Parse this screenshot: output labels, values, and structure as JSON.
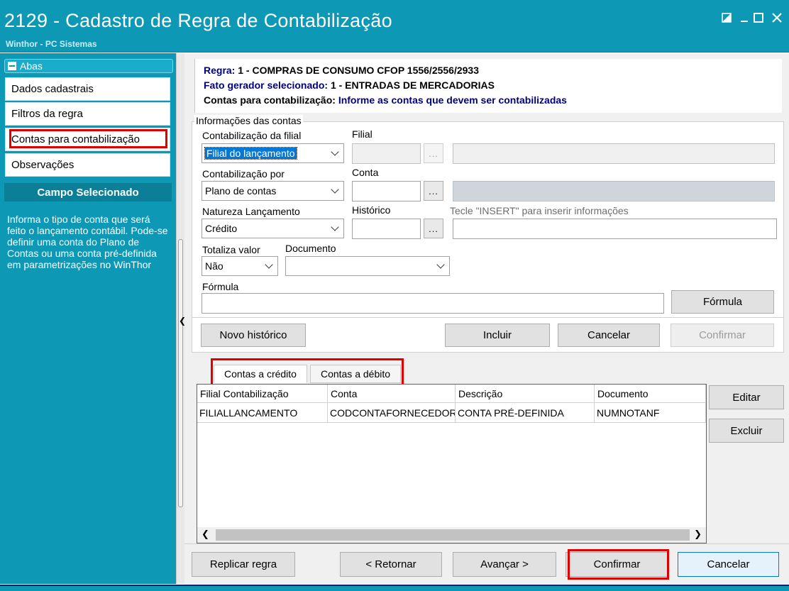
{
  "window": {
    "title": "2129 - Cadastro de Regra de Contabilização",
    "subtitle": "Winthor - PC Sistemas"
  },
  "sidebar": {
    "header": "Abas",
    "items": [
      {
        "label": "Dados cadastrais"
      },
      {
        "label": "Filtros da regra"
      },
      {
        "label": "Contas para contabilização"
      },
      {
        "label": "Observações"
      }
    ],
    "campo_title": "Campo Selecionado",
    "campo_text": "Informa o tipo de conta que será feito o lançamento contábil. Pode-se definir uma conta do Plano de Contas ou uma conta pré-definida em parametrizações no WinThor"
  },
  "info": {
    "regra_label": "Regra:",
    "regra_value": "1 - COMPRAS DE CONSUMO CFOP 1556/2556/2933",
    "fato_label": "Fato gerador selecionado:",
    "fato_value": "1 - ENTRADAS DE MERCADORIAS",
    "contas_label": "Contas para contabilização:",
    "contas_value": "Informe as contas que devem ser contabilizadas"
  },
  "form": {
    "group_title": "Informações das contas",
    "contab_filial_label": "Contabilização da filial",
    "contab_filial_value": "Filial do lançamento",
    "filial_label": "Filial",
    "contab_por_label": "Contabilização por",
    "contab_por_value": "Plano de contas",
    "conta_label": "Conta",
    "natureza_label": "Natureza Lançamento",
    "natureza_value": "Crédito",
    "historico_label": "Histórico",
    "historico_hint": "Tecle  \"INSERT\" para inserir informações",
    "totaliza_label": "Totaliza valor",
    "totaliza_value": "Não",
    "documento_label": "Documento",
    "formula_label": "Fórmula",
    "ellipsis": "..."
  },
  "buttons": {
    "formula": "Fórmula",
    "novo_historico": "Novo histórico",
    "incluir": "Incluir",
    "cancelar": "Cancelar",
    "confirmar": "Confirmar",
    "editar": "Editar",
    "excluir": "Excluir",
    "replicar": "Replicar regra",
    "retornar": "< Retornar",
    "avancar": "Avançar >",
    "confirmar_main": "Confirmar",
    "cancelar_main": "Cancelar"
  },
  "tabs": [
    {
      "label": "Contas a crédito"
    },
    {
      "label": "Contas a débito"
    }
  ],
  "grid": {
    "columns": [
      "Filial Contabilização",
      "Conta",
      "Descrição",
      "Documento"
    ],
    "rows": [
      [
        "FILIALLANCAMENTO",
        "CODCONTAFORNECEDOR",
        "CONTA PRÉ-DEFINIDA",
        "NUMNOTANF"
      ]
    ]
  }
}
